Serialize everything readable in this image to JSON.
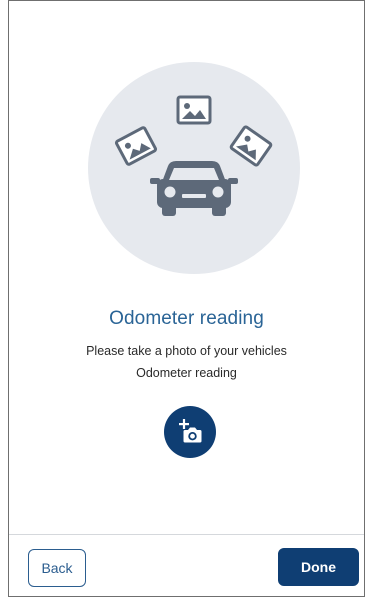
{
  "screen": {
    "title": "Odometer reading",
    "description_line1": "Please take a photo of your vehicles",
    "description_line2": "Odometer reading"
  },
  "icons": {
    "hero": [
      "photo-icon",
      "photo-icon",
      "photo-icon",
      "car-icon"
    ],
    "action": "add-photo-camera-icon"
  },
  "footer": {
    "back_label": "Back",
    "done_label": "Done"
  },
  "colors": {
    "primary": "#0f3e73",
    "title": "#2a6496",
    "hero_bg": "#e6e9ee",
    "icon_gray": "#5d6979"
  }
}
